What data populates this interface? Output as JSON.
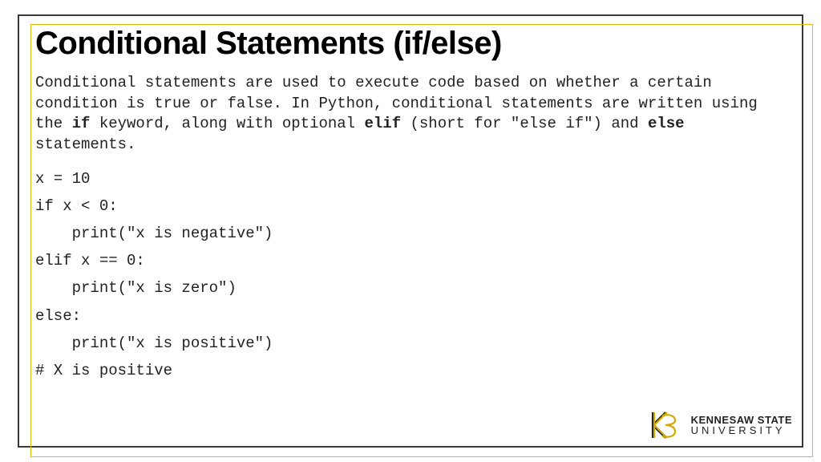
{
  "title": "Conditional Statements (if/else)",
  "description": {
    "part1": "Conditional statements are used to execute code based on whether a certain condition is true or false. In Python, conditional statements are written using the ",
    "kw1": "if",
    "part2": " keyword, along with optional ",
    "kw2": "elif",
    "part3": " (short for \"else if\") and ",
    "kw3": "else",
    "part4": " statements."
  },
  "code": "x = 10\nif x < 0:\n    print(\"x is negative\")\nelif x == 0:\n    print(\"x is zero\")\nelse:\n    print(\"x is positive\")\n# X is positive",
  "logo": {
    "line1": "KENNESAW STATE",
    "line2": "UNIVERSITY"
  }
}
